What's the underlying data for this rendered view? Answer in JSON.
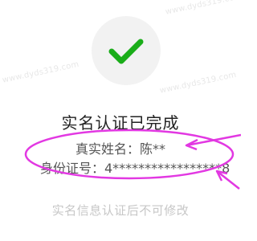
{
  "watermark": "www.dyds319.com",
  "status": {
    "title": "实名认证已完成",
    "icon": "check-icon"
  },
  "identity": {
    "name_line": "真实姓名：陈**",
    "id_line": "身份证号：4*****************8"
  },
  "note": "实名信息认证后不可修改",
  "colors": {
    "check": "#1aad19",
    "annotation": "#e238e2"
  }
}
